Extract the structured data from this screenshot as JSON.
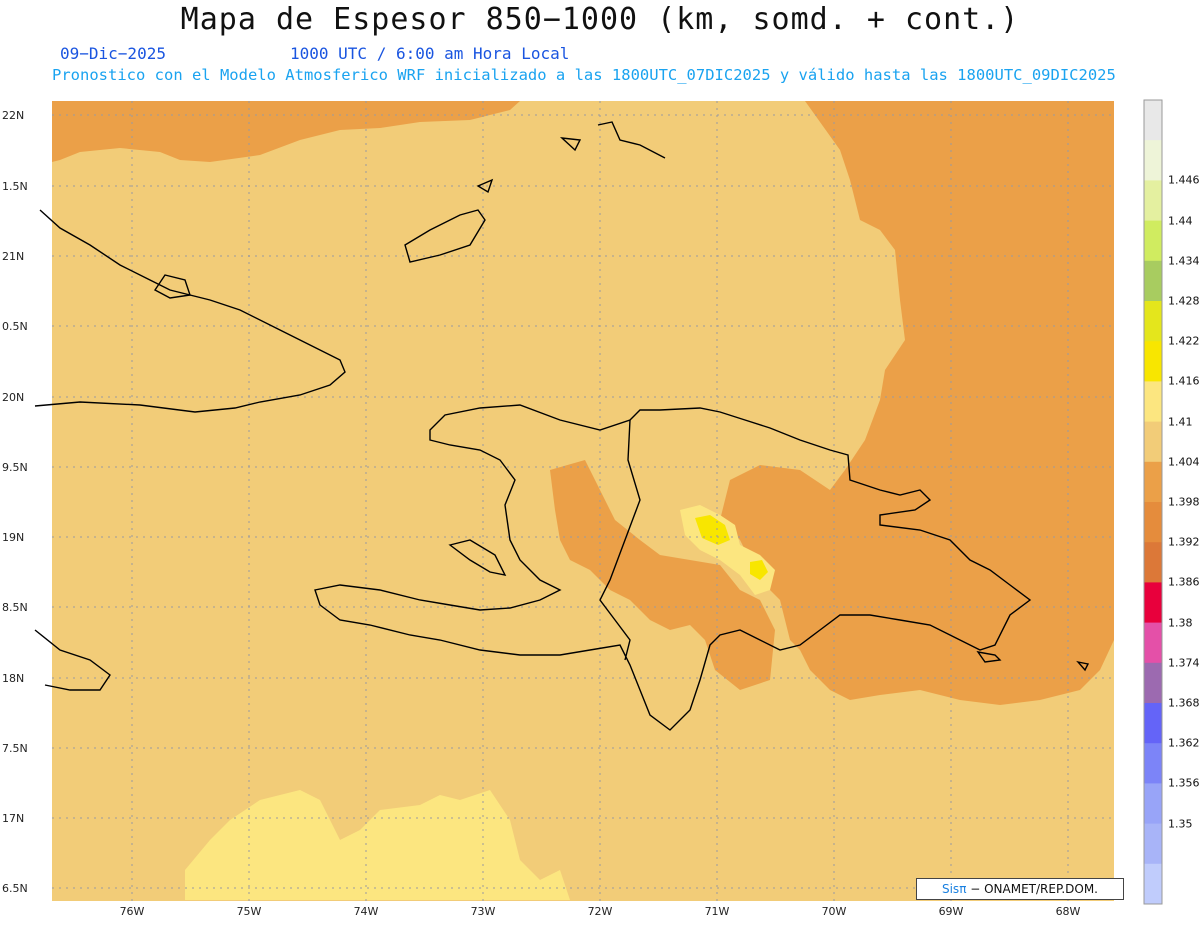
{
  "header": {
    "title": "Mapa de Espesor 850−1000 (km, somd. + cont.)",
    "date": "09−Dic−2025",
    "time": "1000 UTC / 6:00 am Hora Local",
    "description": "Pronostico con el Modelo Atmosferico WRF inicializado a las 1800UTC_07DIC2025 y válido hasta las  1800UTC_09DIC2025"
  },
  "axes": {
    "lat_labels": [
      "22N",
      "1.5N",
      "21N",
      "0.5N",
      "20N",
      "9.5N",
      "19N",
      "8.5N",
      "18N",
      "7.5N",
      "17N",
      "6.5N"
    ],
    "lon_labels": [
      "76W",
      "75W",
      "74W",
      "73W",
      "72W",
      "71W",
      "70W",
      "69W",
      "68W"
    ]
  },
  "colorbar": {
    "labels": [
      "1.446",
      "1.44",
      "1.434",
      "1.428",
      "1.422",
      "1.416",
      "1.41",
      "1.404",
      "1.398",
      "1.392",
      "1.386",
      "1.38",
      "1.374",
      "1.368",
      "1.362",
      "1.356",
      "1.35"
    ],
    "colors": [
      "#e8e8e8",
      "#eef4d8",
      "#e4f0a0",
      "#d0ec60",
      "#a8cc60",
      "#e4e61c",
      "#f8e600",
      "#fce680",
      "#f2cc78",
      "#eba048",
      "#e58c3c",
      "#dc7838",
      "#e8003c",
      "#e450a8",
      "#9c6ab0",
      "#6464f8",
      "#7c84f8",
      "#98a4f8",
      "#a8b4f8",
      "#c0ccfc"
    ]
  },
  "credit": {
    "sis": "Sisπ",
    "text": " − ONAMET/REP.DOM."
  }
}
